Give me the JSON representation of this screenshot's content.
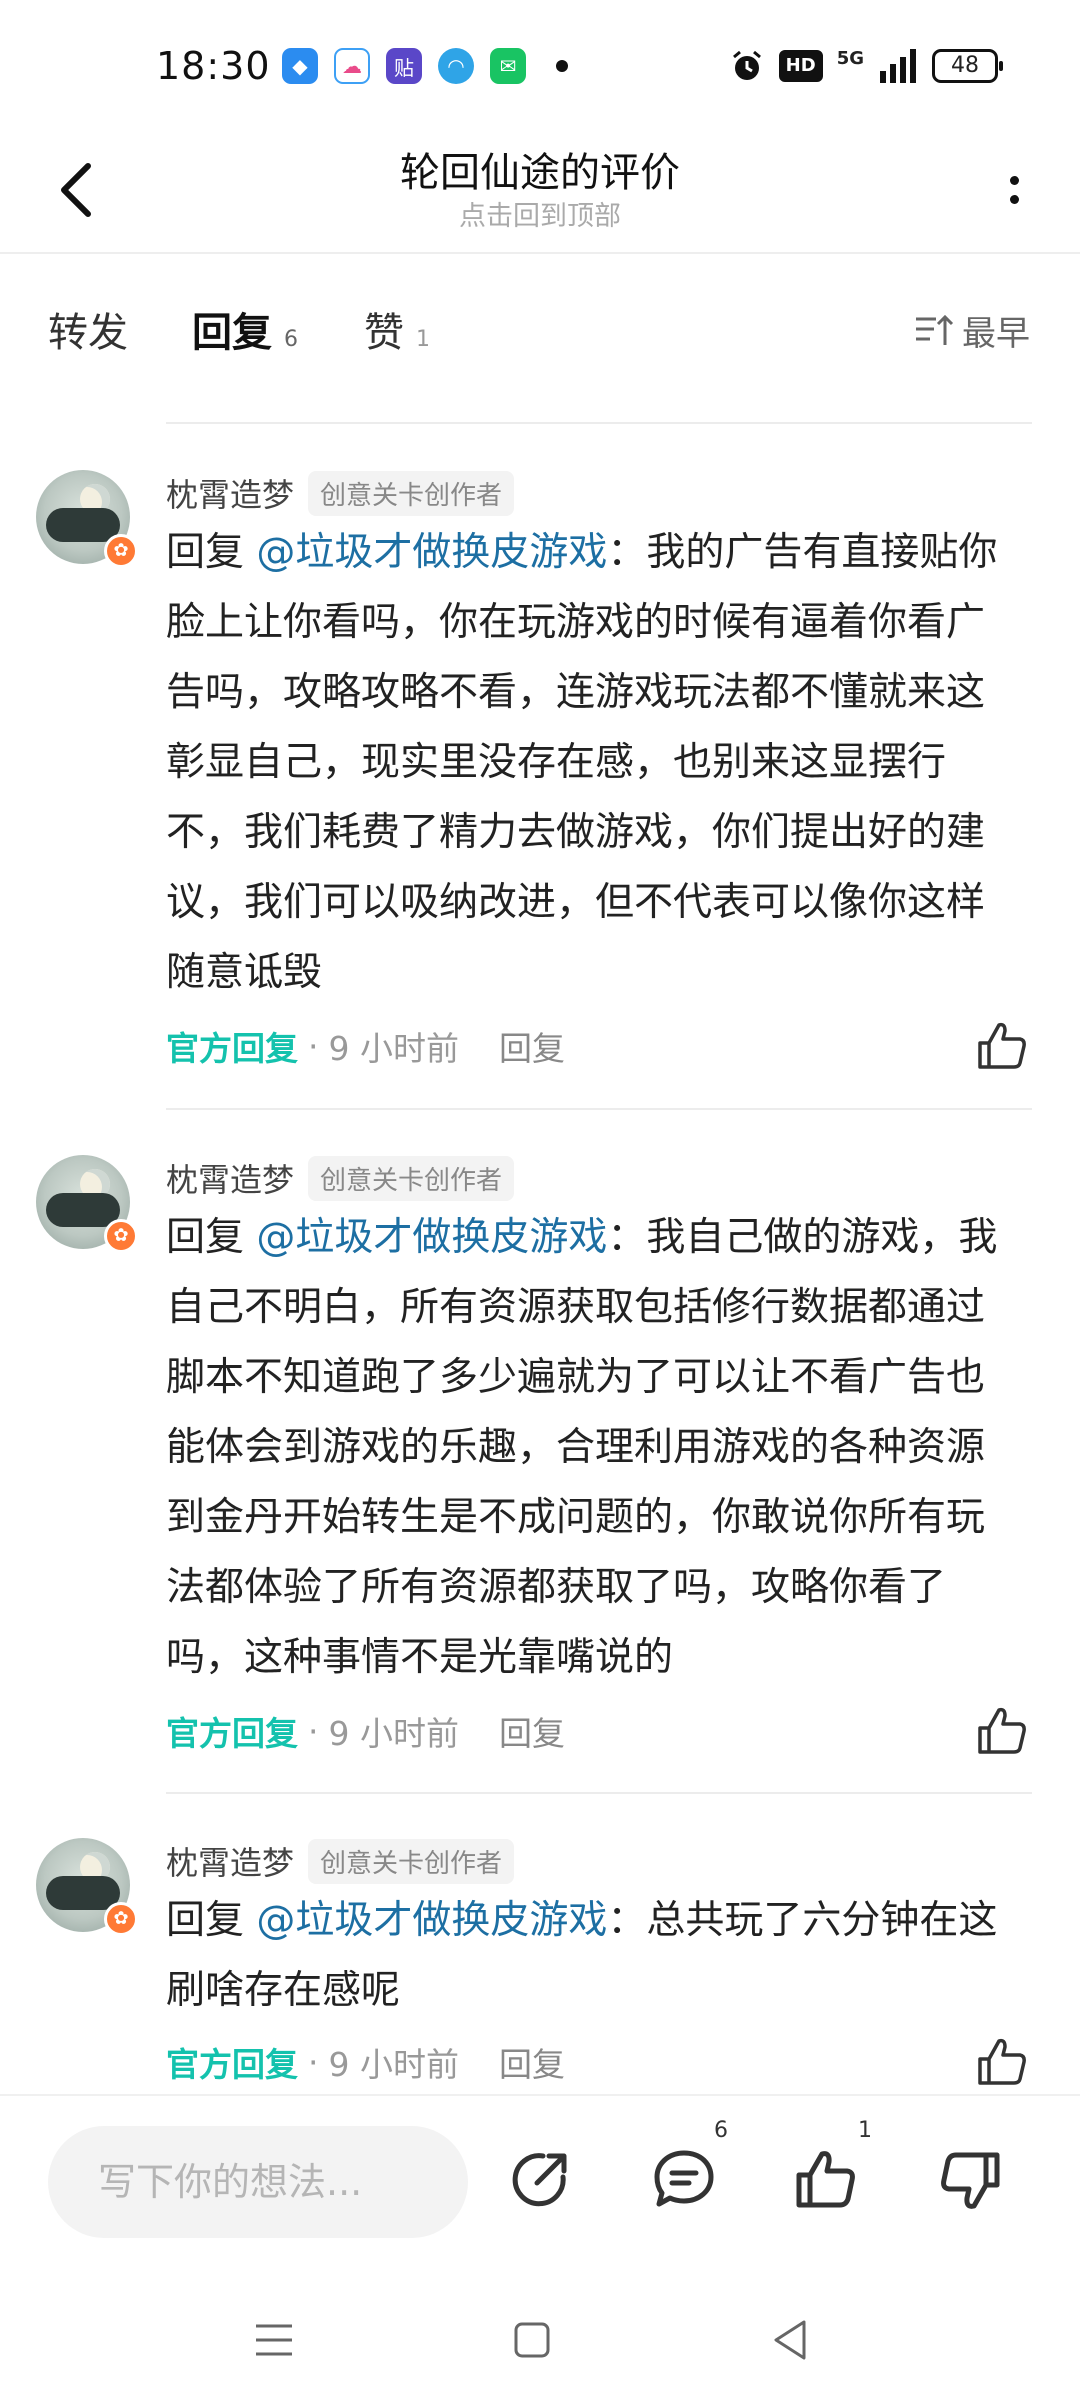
{
  "status_bar": {
    "time": "18:30",
    "app_icons": [
      "browser-app-icon",
      "cloud-app-icon",
      "tieba-app-icon",
      "qq-app-icon",
      "taptap-app-icon"
    ],
    "hd_label": "HD",
    "network": "5G",
    "battery": "48"
  },
  "header": {
    "title": "轮回仙途的评价",
    "subtitle": "点击回到顶部"
  },
  "tabs": [
    {
      "label": "转发",
      "count": ""
    },
    {
      "label": "回复",
      "count": "6"
    },
    {
      "label": "赞",
      "count": "1"
    }
  ],
  "sort_label": "最早",
  "comments": [
    {
      "username": "枕霄造梦",
      "tag": "创意关卡创作者",
      "reply_prefix": "回复 ",
      "mention": "@垃圾才做换皮游戏",
      "text": "：我的广告有直接贴你脸上让你看吗，你在玩游戏的时候有逼着你看广告吗，攻略攻略不看，连游戏玩法都不懂就来这彰显自己，现实里没存在感，也别来这显摆行不，我们耗费了精力去做游戏，你们提出好的建议，我们可以吸纳改进，但不代表可以像你这样随意诋毁",
      "official": "官方回复",
      "time": "9 小时前",
      "reply_label": "回复"
    },
    {
      "username": "枕霄造梦",
      "tag": "创意关卡创作者",
      "reply_prefix": "回复 ",
      "mention": "@垃圾才做换皮游戏",
      "text": "：我自己做的游戏，我自己不明白，所有资源获取包括修行数据都通过脚本不知道跑了多少遍就为了可以让不看广告也能体会到游戏的乐趣，合理利用游戏的各种资源到金丹开始转生是不成问题的，你敢说你所有玩法都体验了所有资源都获取了吗，攻略你看了吗，这种事情不是光靠嘴说的",
      "official": "官方回复",
      "time": "9 小时前",
      "reply_label": "回复"
    },
    {
      "username": "枕霄造梦",
      "tag": "创意关卡创作者",
      "reply_prefix": "回复 ",
      "mention": "@垃圾才做换皮游戏",
      "text": "：总共玩了六分钟在这刷啥存在感呢",
      "official": "官方回复",
      "time": "9 小时前",
      "reply_label": "回复"
    }
  ],
  "bottom_bar": {
    "input_placeholder": "写下你的想法...",
    "comment_count": "6",
    "like_count": "1"
  },
  "colors": {
    "accent": "#14c2ad",
    "mention": "#1d6fa3",
    "vip_badge": "#ff7a35"
  }
}
